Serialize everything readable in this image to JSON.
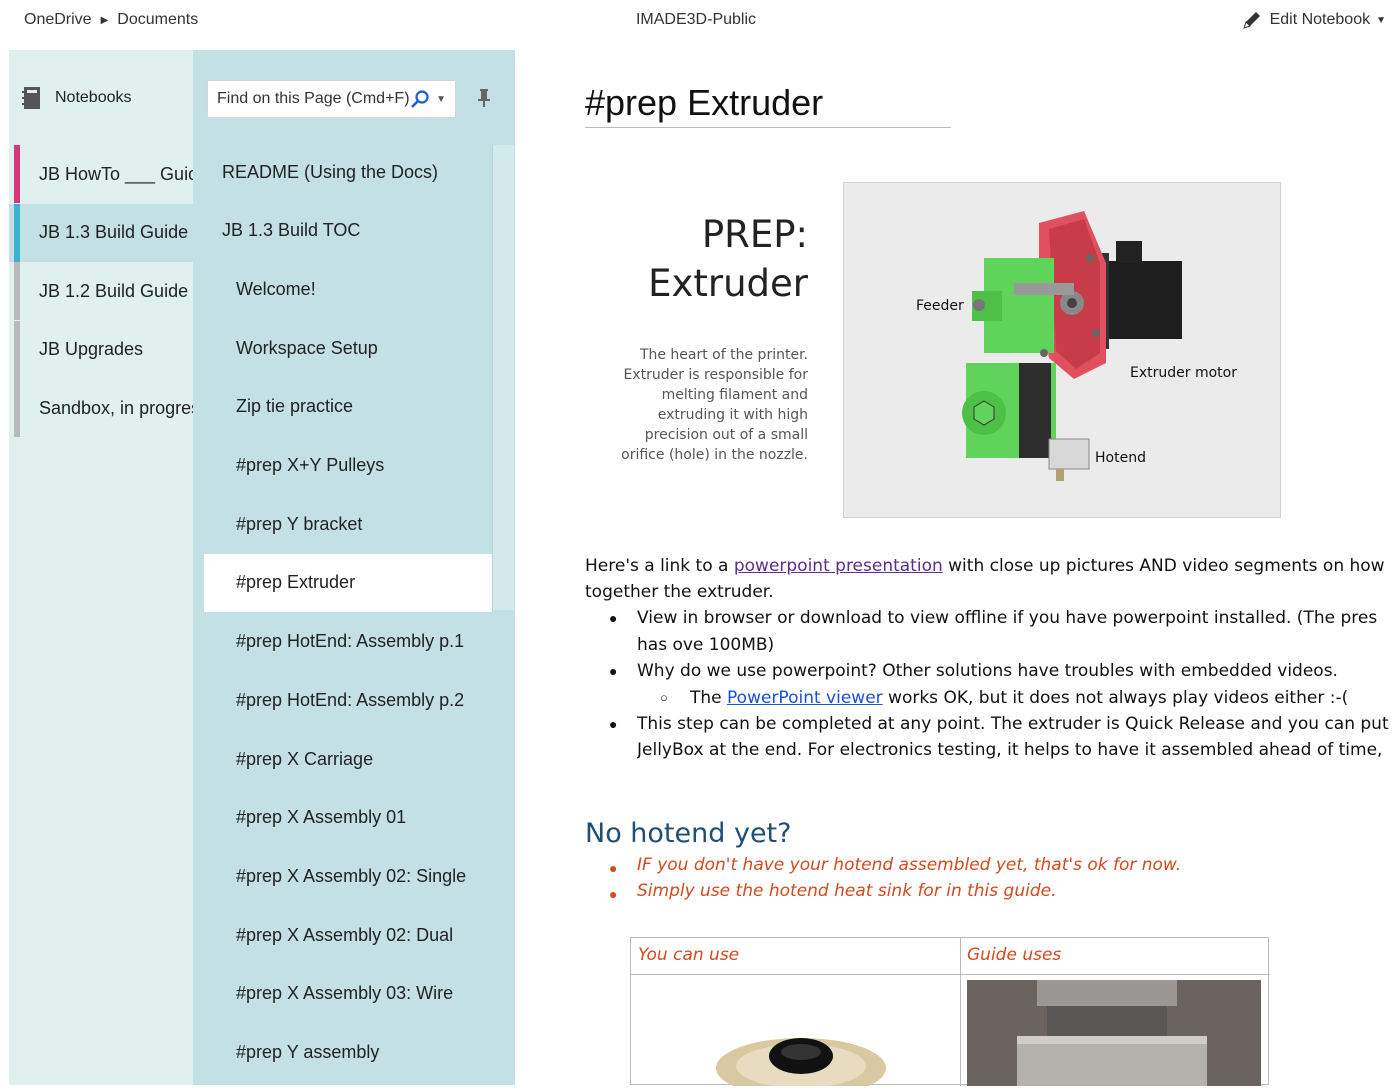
{
  "topbar": {
    "breadcrumb": [
      "OneDrive",
      "Documents"
    ],
    "doc_title": "IMADE3D-Public",
    "edit_label": "Edit Notebook"
  },
  "notebooks": {
    "header": "Notebooks",
    "items": [
      {
        "label": "JB HowTo ___ Guide",
        "color": "#d6367a"
      },
      {
        "label": "JB 1.3 Build Guide",
        "color": "#3bb3d0"
      },
      {
        "label": "JB 1.2 Build Guide",
        "color": "#b9b9b9"
      },
      {
        "label": "JB Upgrades",
        "color": "#b9b9b9"
      },
      {
        "label": "Sandbox, in progress",
        "color": "#b9b9b9"
      }
    ]
  },
  "search": {
    "placeholder": "Find on this Page (Cmd+F)"
  },
  "pages": [
    {
      "label": "README (Using the Docs)",
      "level": 0
    },
    {
      "label": "JB 1.3 Build TOC",
      "level": 0
    },
    {
      "label": "Welcome!",
      "level": 1
    },
    {
      "label": "Workspace Setup",
      "level": 1
    },
    {
      "label": "Zip tie practice",
      "level": 1
    },
    {
      "label": "#prep X+Y Pulleys",
      "level": 1
    },
    {
      "label": "#prep Y bracket",
      "level": 1
    },
    {
      "label": "#prep Extruder",
      "level": 1,
      "active": true
    },
    {
      "label": "#prep HotEnd: Assembly p.1",
      "level": 1
    },
    {
      "label": "#prep HotEnd: Assembly p.2",
      "level": 1
    },
    {
      "label": "#prep X Carriage",
      "level": 1
    },
    {
      "label": "#prep X Assembly 01",
      "level": 1
    },
    {
      "label": "#prep X Assembly 02: Single",
      "level": 1
    },
    {
      "label": "#prep X Assembly 02: Dual",
      "level": 1
    },
    {
      "label": "#prep X Assembly 03: Wire",
      "level": 1
    },
    {
      "label": "#prep Y assembly",
      "level": 1
    }
  ],
  "page": {
    "title": "#prep Extruder",
    "prep_heading_1": "PREP:",
    "prep_heading_2": "Extruder",
    "prep_desc": [
      "The heart of the printer.",
      "Extruder is responsible for",
      "melting filament and",
      "extruding it with high",
      "precision out of a small",
      "orifice (hole) in the nozzle."
    ],
    "figure_labels": {
      "feeder": "Feeder",
      "motor": "Extruder motor",
      "hotend": "Hotend"
    },
    "para1_before": "Here's a link to a ",
    "para1_link": "powerpoint presentation",
    "para1_after": " with close up pictures AND video segments on how",
    "para1_line2": "together the extruder.",
    "bullet1_line1": "View in browser or download to view offline if you have powerpoint installed. (The pres",
    "bullet1_line2": "has ove 100MB)",
    "bullet2": "Why do we use powerpoint? Other solutions have troubles with embedded videos.",
    "sub_bullet_before": "The ",
    "sub_bullet_link": "PowerPoint viewer",
    "sub_bullet_after": " works OK, but it does not always play videos either :-(",
    "bullet3_line1": "This step can be completed at any point. The extruder is Quick Release and you can put",
    "bullet3_line2": "JellyBox at the end. For electronics testing, it helps to have it assembled ahead of time,",
    "h2": "No hotend yet?",
    "red_bullet1": "IF you don't have your hotend assembled yet, that's ok for now.",
    "red_bullet2": "Simply use the hotend heat sink for in this guide.",
    "table_headers": [
      "You can use",
      "Guide uses"
    ]
  },
  "colors": {
    "notebook_bg": "#dff0ef",
    "section_bg": "#c3e1e5",
    "heading_blue": "#1f4e79",
    "accent_red": "#d24a1e",
    "part_green": "#5fd35a",
    "part_pink": "#e0505e"
  }
}
